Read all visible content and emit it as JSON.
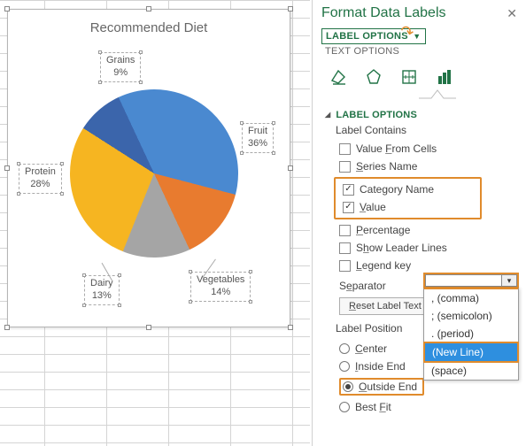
{
  "chart_data": {
    "type": "pie",
    "title": "Recommended Diet",
    "categories": [
      "Fruit",
      "Vegetables",
      "Dairy",
      "Protein",
      "Grains"
    ],
    "values": [
      36,
      14,
      13,
      28,
      9
    ],
    "colors": [
      "#4a89d0",
      "#e87b2f",
      "#a5a5a5",
      "#f6b521",
      "#3b65ab"
    ]
  },
  "labels": {
    "fruit": {
      "name": "Fruit",
      "pct": "36%"
    },
    "veg": {
      "name": "Vegetables",
      "pct": "14%"
    },
    "dairy": {
      "name": "Dairy",
      "pct": "13%"
    },
    "protein": {
      "name": "Protein",
      "pct": "28%"
    },
    "grains": {
      "name": "Grains",
      "pct": "9%"
    }
  },
  "pane": {
    "title": "Format Data Labels",
    "tabs": {
      "options": "LABEL OPTIONS",
      "text": "TEXT OPTIONS"
    },
    "section": "LABEL OPTIONS",
    "label_contains": "Label Contains",
    "checks": {
      "cells": {
        "label": "Value From Cells",
        "on": false,
        "u": "F"
      },
      "series": {
        "label": "Series Name",
        "on": false,
        "u": "S"
      },
      "category": {
        "label": "Category Name",
        "on": true,
        "u": ""
      },
      "value": {
        "label": "Value",
        "on": true,
        "u": "V"
      },
      "percentage": {
        "label": "Percentage",
        "on": false,
        "u": "P"
      },
      "leader": {
        "label": "Show Leader Lines",
        "on": false,
        "u": "h"
      },
      "legend": {
        "label": "Legend key",
        "on": false,
        "u": "L"
      }
    },
    "separator_label": "Separator",
    "reset": "Reset Label Text",
    "position_label": "Label Position",
    "radios": {
      "center": {
        "label": "Center",
        "on": false
      },
      "inside": {
        "label": "Inside End",
        "on": false
      },
      "outside": {
        "label": "Outside End",
        "on": true
      },
      "bestfit": {
        "label": "Best Fit",
        "on": false
      }
    },
    "sep_options": [
      ", (comma)",
      "; (semicolon)",
      ". (period)",
      "(New Line)",
      "  (space)"
    ],
    "sep_selected": "(New Line)"
  }
}
